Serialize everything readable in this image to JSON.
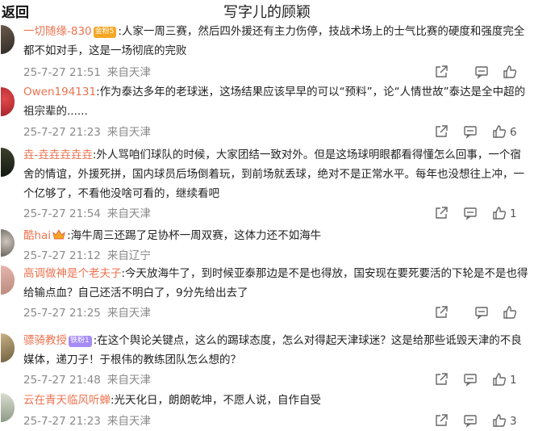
{
  "header": {
    "back_label": "返回",
    "title": "写字儿的顾颖"
  },
  "comments": [
    {
      "username": "一切随缘-830",
      "badge": "金粉5",
      "text": ":人家一周三赛，然后四外援还有主力伤停，技战术场上的士气比赛的硬度和强度完全都不如对手，这是一场彻底的完败",
      "time": "25-7-27 21:51",
      "location": "来自天津",
      "likes": ""
    },
    {
      "username": "Owen194131",
      "badge": "",
      "text": ":作为泰达多年的老球迷，这场结果应该早早的可以“预料”，论“人情世故”泰达是全中超的祖宗辈的......",
      "time": "25-7-27 21:23",
      "location": "来自天津",
      "likes": "6"
    },
    {
      "username": "垚-垚垚垚垚垚",
      "badge": "",
      "text": ":外人骂咱们球队的时候，大家团结一致对外。但是这场球明眼都看得懂怎么回事，一个宿舍的情谊，外援死拼，国内球员后场倒着玩，到前场就丢球，绝对不是正常水平。每年也没想往上冲，一个亿够了，不看他没啥可看的，继续看吧",
      "time": "25-7-27 21:54",
      "location": "来自天津",
      "likes": "1"
    },
    {
      "username": "酷hai",
      "badge": "",
      "text": ":海牛周三还踢了足协杯一周双赛，这体力还不如海牛",
      "time": "25-7-27 21:12",
      "location": "来自辽宁",
      "likes": ""
    },
    {
      "username": "高调做神是个老夫子",
      "badge": "",
      "text": ":今天放海牛了，到时候亚泰那边是不是也得放，国安现在要死要活的下轮是不是也得给输点血？自己还活不明白了，9分先给出去了",
      "time": "25-7-27 21:25",
      "location": "来自天津",
      "likes": ""
    },
    {
      "username": "骠骑教授",
      "badge": "铁粉1",
      "text": ":在这个舆论关键点，这么的踢球态度，怎么对得起天津球迷？这是给那些诋毁天津的不良媒体，递刀子！于根伟的教练团队怎么想的？",
      "time": "25-7-27 21:48",
      "location": "来自天津",
      "likes": "1"
    },
    {
      "username": "云在青天临风听蝉",
      "badge": "",
      "text": ":光天化日，朗朗乾坤，不愿人说，自作自受",
      "time": "25-7-27 21:23",
      "location": "来自天津",
      "likes": "3"
    }
  ],
  "icons": [
    "share-icon",
    "comment-icon",
    "like-icon",
    "crown-icon"
  ],
  "colors": {
    "username": "#eb7350",
    "meta": "#8a8a8a",
    "gold_badge": "#f5a623",
    "purple_badge": "#a58bf5"
  }
}
